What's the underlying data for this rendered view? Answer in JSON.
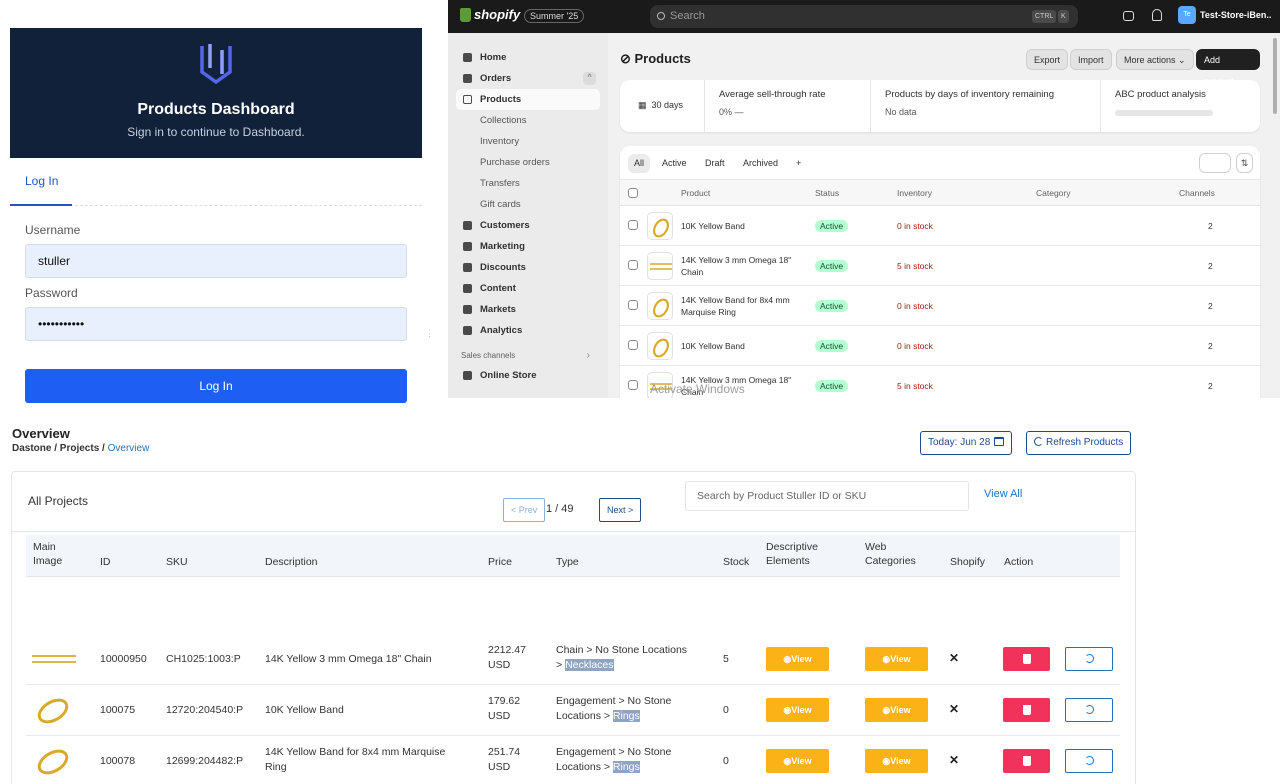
{
  "login": {
    "title": "Products Dashboard",
    "subtitle": "Sign in to continue to Dashboard.",
    "tab": "Log In",
    "username_label": "Username",
    "username_value": "stuller",
    "password_label": "Password",
    "password_value": "•••••••••••",
    "submit": "Log In",
    "logo_color": "#5566e8"
  },
  "shopify": {
    "brand": "shopify",
    "edition": "Summer '25",
    "search_placeholder": "Search",
    "kbd_ctrl": "CTRL",
    "kbd_k": "K",
    "avatar": "Te",
    "store_name": "Test-Store-iBen..",
    "sidebar": {
      "items": [
        {
          "label": "Home",
          "type": "head"
        },
        {
          "label": "Orders",
          "type": "head",
          "badge": "^"
        },
        {
          "label": "Products",
          "type": "active"
        },
        {
          "label": "Collections",
          "type": "sub"
        },
        {
          "label": "Inventory",
          "type": "sub"
        },
        {
          "label": "Purchase orders",
          "type": "sub"
        },
        {
          "label": "Transfers",
          "type": "sub"
        },
        {
          "label": "Gift cards",
          "type": "sub"
        },
        {
          "label": "Customers",
          "type": "head"
        },
        {
          "label": "Marketing",
          "type": "head"
        },
        {
          "label": "Discounts",
          "type": "head"
        },
        {
          "label": "Content",
          "type": "head"
        },
        {
          "label": "Markets",
          "type": "head"
        },
        {
          "label": "Analytics",
          "type": "head"
        }
      ],
      "section": "Sales channels",
      "online_store": "Online Store"
    },
    "page_title": "Products",
    "buttons": {
      "export": "Export",
      "import": "Import",
      "more": "More actions",
      "add": "Add product"
    },
    "analytics": {
      "days": "30 days",
      "sell_through_label": "Average sell-through rate",
      "sell_through_value": "0%  —",
      "days_inv_label": "Products by days of inventory remaining",
      "days_inv_value": "No data",
      "abc_label": "ABC product analysis"
    },
    "filters": [
      "All",
      "Active",
      "Draft",
      "Archived",
      "+"
    ],
    "columns": {
      "product": "Product",
      "status": "Status",
      "inventory": "Inventory",
      "category": "Category",
      "channels": "Channels"
    },
    "rows": [
      {
        "name": "10K Yellow Band",
        "status": "Active",
        "inventory": "0 in stock",
        "channels": "2"
      },
      {
        "name": "14K Yellow 3 mm Omega 18\" Chain",
        "status": "Active",
        "inventory": "5 in stock",
        "channels": "2"
      },
      {
        "name": "14K Yellow Band for 8x4 mm Marquise Ring",
        "status": "Active",
        "inventory": "0 in stock",
        "channels": "2"
      },
      {
        "name": "10K Yellow Band",
        "status": "Active",
        "inventory": "0 in stock",
        "channels": "2"
      },
      {
        "name": "14K Yellow 3 mm Omega 18\" Chain",
        "status": "Active",
        "inventory": "5 in stock",
        "channels": "2"
      }
    ],
    "watermark": "Activate Windows"
  },
  "overview": {
    "title": "Overview",
    "breadcrumb": {
      "a": "Dastone",
      "b": "Projects",
      "current": "Overview"
    },
    "date_button": "Today: Jun 28",
    "refresh_button": "Refresh Products",
    "card_title": "All Projects",
    "search_placeholder": "Search by Product Stuller ID or SKU",
    "view_all": "View All",
    "pager": {
      "prev": "< Prev",
      "page": "1 / 49",
      "next": "Next >"
    },
    "columns": {
      "image_a": "Main",
      "image_b": "Image",
      "id": "ID",
      "sku": "SKU",
      "description": "Description",
      "price": "Price",
      "type": "Type",
      "stock": "Stock",
      "desc_el_a": "Descriptive",
      "desc_el_b": "Elements",
      "web_cat_a": "Web",
      "web_cat_b": "Categories",
      "shopify": "Shopify",
      "action": "Action"
    },
    "view_label": "View",
    "shopify_mark": "✕",
    "rows": [
      {
        "id": "10000950",
        "sku": "CH1025:1003:P",
        "description": "14K Yellow 3 mm Omega 18\" Chain",
        "price_a": "2212.47",
        "price_b": "USD",
        "type_a": "Chain > No Stone Locations",
        "type_b": "> ",
        "type_hl": "Necklaces",
        "stock": "5",
        "thumb": "chain"
      },
      {
        "id": "100075",
        "sku": "12720:204540:P",
        "description": "10K Yellow Band",
        "price_a": "179.62",
        "price_b": "USD",
        "type_a": "Engagement > No Stone",
        "type_b": "Locations > ",
        "type_hl": "Rings",
        "stock": "0",
        "thumb": "band"
      },
      {
        "id": "100078",
        "sku": "12699:204482:P",
        "description": "14K Yellow Band for 8x4 mm Marquise Ring",
        "price_a": "251.74",
        "price_b": "USD",
        "type_a": "Engagement > No Stone",
        "type_b": "Locations > ",
        "type_hl": "Rings",
        "stock": "0",
        "thumb": "band"
      }
    ]
  }
}
